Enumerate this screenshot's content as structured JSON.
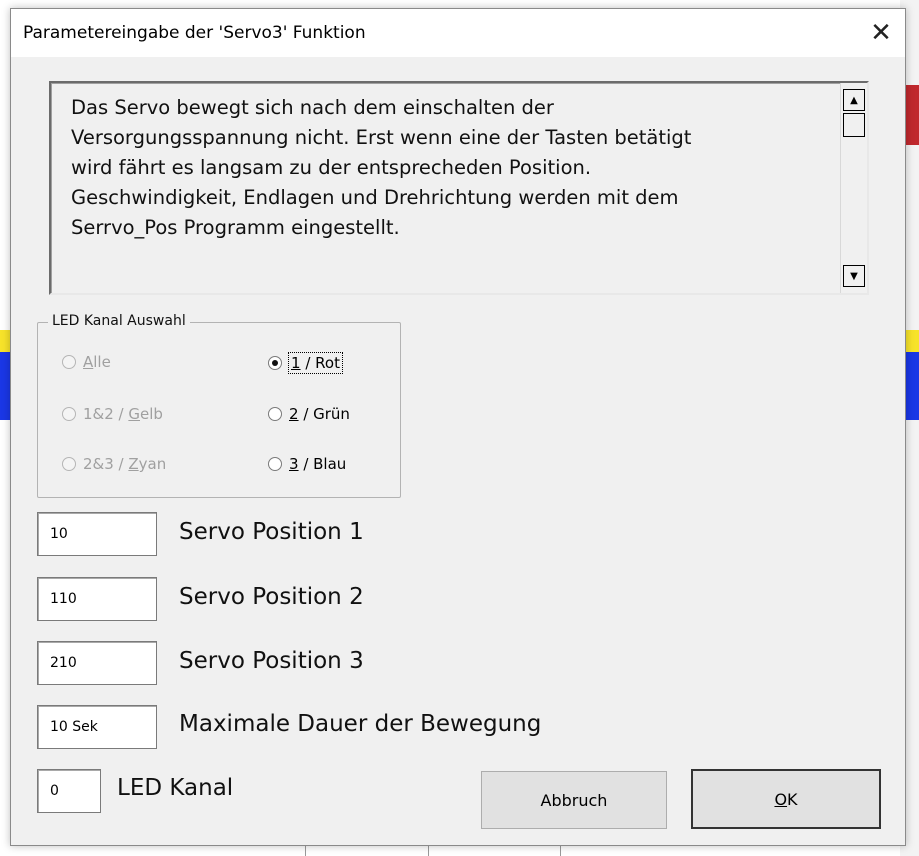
{
  "dialog": {
    "title": "Parametereingabe der 'Servo3' Funktion",
    "close_symbol": "✕"
  },
  "description": {
    "text": "Das Servo bewegt sich nach dem einschalten der\nVersorgungsspannung nicht. Erst wenn eine der Tasten betätigt\nwird fährt es langsam zu der entsprecheden Position.\nGeschwindigkeit, Endlagen und Drehrichtung werden mit dem\nSerrvo_Pos Programm eingestellt."
  },
  "led_group": {
    "legend": "LED Kanal Auswahl",
    "options": [
      {
        "prefix": "",
        "accel": "A",
        "suffix": "lle",
        "checked": false,
        "enabled": false
      },
      {
        "prefix": "",
        "accel": "1",
        "suffix": " / Rot",
        "checked": true,
        "enabled": true
      },
      {
        "prefix": "1&2 / ",
        "accel": "G",
        "suffix": "elb",
        "checked": false,
        "enabled": false
      },
      {
        "prefix": "",
        "accel": "2",
        "suffix": " / Grün",
        "checked": false,
        "enabled": true
      },
      {
        "prefix": "2&3 / ",
        "accel": "Z",
        "suffix": "yan",
        "checked": false,
        "enabled": false
      },
      {
        "prefix": "",
        "accel": "3",
        "suffix": " / Blau",
        "checked": false,
        "enabled": true
      }
    ]
  },
  "fields": [
    {
      "value": "10",
      "label": "Servo Position 1"
    },
    {
      "value": "110",
      "label": "Servo Position 2"
    },
    {
      "value": "210",
      "label": "Servo Position 3"
    },
    {
      "value": "10 Sek",
      "label": "Maximale Dauer der Bewegung"
    },
    {
      "value": "0",
      "label": "LED Kanal"
    }
  ],
  "buttons": {
    "cancel": "Abbruch",
    "ok_accel": "O",
    "ok_suffix": "K"
  },
  "colors": {
    "dialog_bg": "#f0f0f0",
    "sheet_blue": "#1a37e6",
    "sheet_yellow": "#f7e32a",
    "sheet_red": "#c0282d"
  }
}
